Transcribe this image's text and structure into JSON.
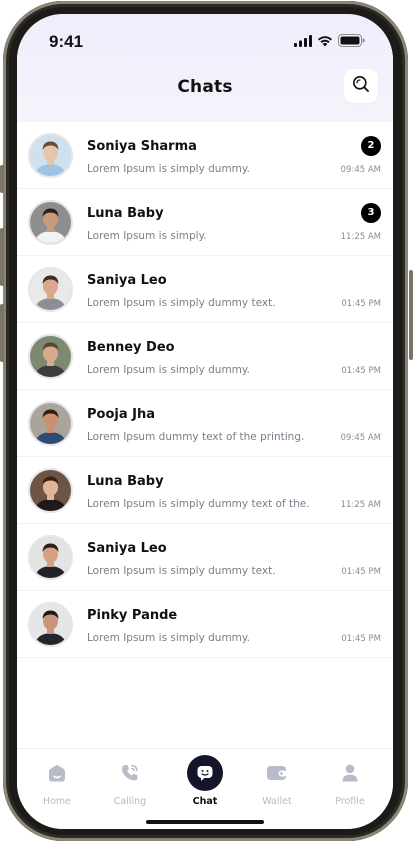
{
  "status_bar": {
    "time": "9:41"
  },
  "header": {
    "title": "Chats"
  },
  "chats": [
    {
      "name": "Soniya Sharma",
      "message": "Lorem Ipsum is simply dummy.",
      "time": "09:45 AM",
      "unread": "2",
      "skin": "#e8c4a8",
      "hair": "#6b4a36",
      "shirt": "#9fc3e6",
      "bg": "#cfe1ef"
    },
    {
      "name": "Luna Baby",
      "message": "Lorem Ipsum is simply.",
      "time": "11:25 AM",
      "unread": "3",
      "skin": "#c89a78",
      "hair": "#2b211c",
      "shirt": "#f2f2f2",
      "bg": "#8e8e8e"
    },
    {
      "name": "Saniya Leo",
      "message": "Lorem Ipsum is simply dummy text.",
      "time": "01:45 PM",
      "unread": "",
      "skin": "#d7a98a",
      "hair": "#3d2c22",
      "shirt": "#8a8f96",
      "bg": "#e9e9e9"
    },
    {
      "name": "Benney Deo",
      "message": "Lorem Ipsum is simply dummy.",
      "time": "01:45 PM",
      "unread": "",
      "skin": "#d6ab8c",
      "hair": "#5a4533",
      "shirt": "#3c3c3c",
      "bg": "#7d8a72"
    },
    {
      "name": "Pooja Jha",
      "message": "Lorem Ipsum dummy text of the printing.",
      "time": "09:45 AM",
      "unread": "",
      "skin": "#c99172",
      "hair": "#2c1f18",
      "shirt": "#2f4d73",
      "bg": "#a9a49c"
    },
    {
      "name": "Luna Baby",
      "message": "Lorem Ipsum is simply dummy text of the.",
      "time": "11:25 AM",
      "unread": "",
      "skin": "#e2b598",
      "hair": "#3a2218",
      "shirt": "#1e1a18",
      "bg": "#6d5444"
    },
    {
      "name": "Saniya Leo",
      "message": "Lorem Ipsum is simply dummy text.",
      "time": "01:45 PM",
      "unread": "",
      "skin": "#d4a283",
      "hair": "#2a1e17",
      "shirt": "#1f2226",
      "bg": "#e3e3e3"
    },
    {
      "name": "Pinky Pande",
      "message": "Lorem Ipsum is simply dummy.",
      "time": "01:45 PM",
      "unread": "",
      "skin": "#c8977a",
      "hair": "#211814",
      "shirt": "#24262b",
      "bg": "#e6e6e6"
    }
  ],
  "tabs": [
    {
      "label": "Home",
      "icon": "home-icon"
    },
    {
      "label": "Calling",
      "icon": "phone-icon"
    },
    {
      "label": "Chat",
      "icon": "chat-icon"
    },
    {
      "label": "Wallet",
      "icon": "wallet-icon"
    },
    {
      "label": "Profile",
      "icon": "profile-icon"
    }
  ],
  "colors": {
    "accent": "#14142b",
    "header_bg": "#f1ecfb",
    "badge": "#000000",
    "muted": "#7c7c8a"
  }
}
